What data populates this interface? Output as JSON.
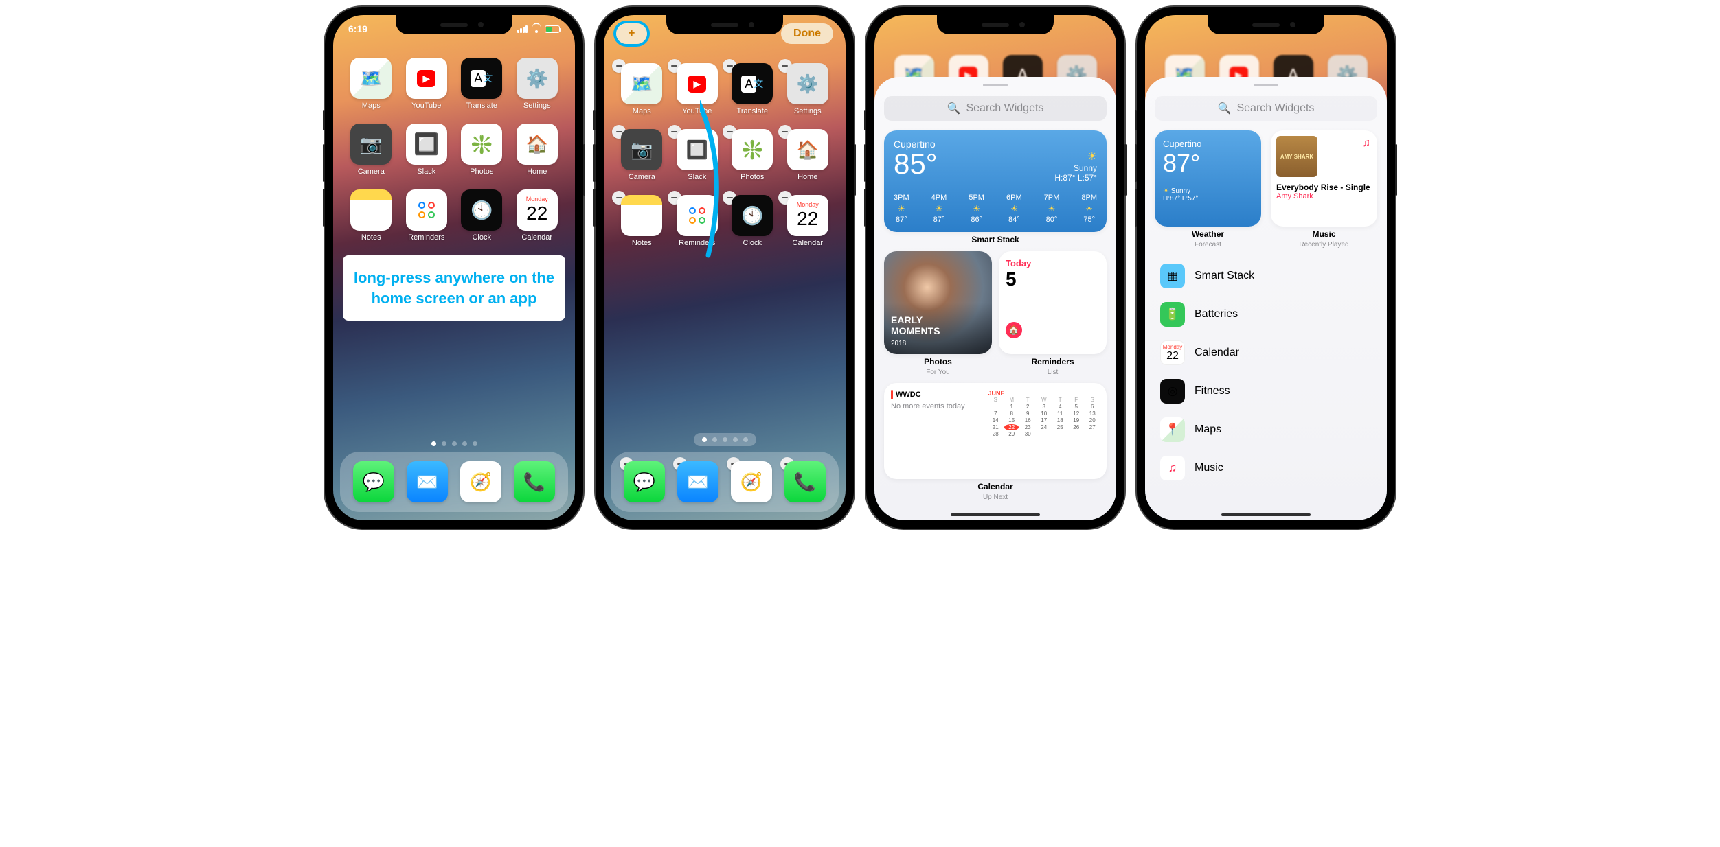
{
  "status": {
    "time": "6:19"
  },
  "tip": "long-press anywhere on the home screen or an app",
  "jiggle": {
    "done": "Done",
    "plus": "+"
  },
  "apps": {
    "maps": "Maps",
    "youtube": "YouTube",
    "translate": "Translate",
    "settings": "Settings",
    "camera": "Camera",
    "slack": "Slack",
    "photos": "Photos",
    "home": "Home",
    "notes": "Notes",
    "reminders": "Reminders",
    "clock": "Clock",
    "calendar": "Calendar"
  },
  "cal_badge": {
    "day": "Monday",
    "num": "22"
  },
  "search_placeholder": "Search Widgets",
  "weather": {
    "location": "Cupertino",
    "temp": "85°",
    "cond_icon": "☀︎",
    "cond": "Sunny",
    "hilo": "H:87° L:57°",
    "hours": [
      {
        "h": "3PM",
        "t": "87°"
      },
      {
        "h": "4PM",
        "t": "87°"
      },
      {
        "h": "5PM",
        "t": "86°"
      },
      {
        "h": "6PM",
        "t": "84°"
      },
      {
        "h": "7PM",
        "t": "80°"
      },
      {
        "h": "8PM",
        "t": "75°"
      }
    ]
  },
  "captions": {
    "stack": "Smart Stack",
    "photos_t": "Photos",
    "photos_s": "For You",
    "rem_t": "Reminders",
    "rem_s": "List",
    "cal_t": "Calendar",
    "cal_s": "Up Next",
    "weather_t": "Weather",
    "weather_s": "Forecast",
    "music_t": "Music",
    "music_s": "Recently Played"
  },
  "photo_overlay": {
    "l1": "EARLY",
    "l2": "MOMENTS",
    "l3": "2018"
  },
  "reminders": {
    "label": "Today",
    "count": "5"
  },
  "upnext": {
    "title": "WWDC",
    "sub": "No more events today"
  },
  "mini_cal": {
    "month": "JUNE",
    "hd": [
      "S",
      "M",
      "T",
      "W",
      "T",
      "F",
      "S"
    ],
    "rows": [
      [
        "",
        "1",
        "2",
        "3",
        "4",
        "5",
        "6"
      ],
      [
        "7",
        "8",
        "9",
        "10",
        "11",
        "12",
        "13"
      ],
      [
        "14",
        "15",
        "16",
        "17",
        "18",
        "19",
        "20"
      ],
      [
        "21",
        "22",
        "23",
        "24",
        "25",
        "26",
        "27"
      ],
      [
        "28",
        "29",
        "30",
        "",
        "",
        "",
        ""
      ]
    ],
    "today": "22"
  },
  "weather_small": {
    "location": "Cupertino",
    "temp": "87°",
    "icon": "☀︎",
    "cond": "Sunny",
    "hilo": "H:87° L:57°"
  },
  "music": {
    "title": "Everybody Rise - Single",
    "artist": "Amy Shark",
    "cover_text": "AMY SHARK"
  },
  "widget_list": [
    {
      "key": "stack",
      "label": "Smart Stack"
    },
    {
      "key": "batt",
      "label": "Batteries"
    },
    {
      "key": "cal",
      "label": "Calendar"
    },
    {
      "key": "fit",
      "label": "Fitness"
    },
    {
      "key": "maps",
      "label": "Maps"
    },
    {
      "key": "music",
      "label": "Music"
    }
  ]
}
